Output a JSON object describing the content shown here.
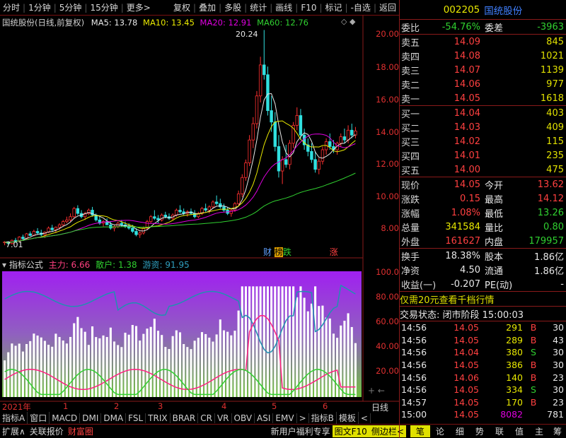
{
  "toolbar": {
    "items": [
      "分时",
      "1分钟",
      "5分钟",
      "15分钟",
      "更多>"
    ],
    "right": [
      "复权",
      "叠加",
      "多股",
      "统计",
      "画线",
      "F10",
      "标记",
      "-自选",
      "返回"
    ]
  },
  "chart": {
    "title": "国统股份(日线,前复权)",
    "ma5": "MA5: 13.78",
    "ma10": "MA10: 13.45",
    "ma20": "MA20: 12.91",
    "ma60": "MA60: 12.76",
    "high_label": "20.24",
    "low_label": "7.01",
    "yaxis": [
      "20.00",
      "18.00",
      "16.00",
      "14.00",
      "12.00",
      "10.00",
      "8.00"
    ],
    "events": [
      "财",
      "榜",
      "跌",
      "涨"
    ],
    "ohlc": [
      [
        7.2,
        7.3,
        7.05,
        7.25
      ],
      [
        7.25,
        7.3,
        7.1,
        7.15
      ],
      [
        7.15,
        7.4,
        7.1,
        7.35
      ],
      [
        7.35,
        7.5,
        7.2,
        7.3
      ],
      [
        7.3,
        7.6,
        7.25,
        7.55
      ],
      [
        7.55,
        7.7,
        7.4,
        7.45
      ],
      [
        7.45,
        7.8,
        7.4,
        7.75
      ],
      [
        7.75,
        7.9,
        7.6,
        7.65
      ],
      [
        7.65,
        8.0,
        7.6,
        7.9
      ],
      [
        7.9,
        8.1,
        7.7,
        7.8
      ],
      [
        7.8,
        8.0,
        7.6,
        7.7
      ],
      [
        7.7,
        7.9,
        7.5,
        7.85
      ],
      [
        7.85,
        8.2,
        7.8,
        8.1
      ],
      [
        8.1,
        8.3,
        7.9,
        8.0
      ],
      [
        8.0,
        8.2,
        7.8,
        8.15
      ],
      [
        8.15,
        8.4,
        8.0,
        8.3
      ],
      [
        8.3,
        8.6,
        8.2,
        8.5
      ],
      [
        8.5,
        8.8,
        8.4,
        8.6
      ],
      [
        8.6,
        9.0,
        8.5,
        8.8
      ],
      [
        8.8,
        9.4,
        8.7,
        9.3
      ],
      [
        9.3,
        9.5,
        8.9,
        9.0
      ],
      [
        9.0,
        9.2,
        8.7,
        8.8
      ],
      [
        8.8,
        9.1,
        8.6,
        9.0
      ],
      [
        9.0,
        9.3,
        8.9,
        9.2
      ],
      [
        9.2,
        9.4,
        8.8,
        8.9
      ],
      [
        8.9,
        9.0,
        8.5,
        8.6
      ],
      [
        8.6,
        8.8,
        8.3,
        8.4
      ],
      [
        8.4,
        8.6,
        8.2,
        8.5
      ],
      [
        8.5,
        8.7,
        8.3,
        8.3
      ],
      [
        8.3,
        8.5,
        8.0,
        8.1
      ],
      [
        8.1,
        8.3,
        7.9,
        8.2
      ],
      [
        8.2,
        8.5,
        8.1,
        8.4
      ],
      [
        8.4,
        8.6,
        8.2,
        8.3
      ],
      [
        8.3,
        8.5,
        8.1,
        8.2
      ],
      [
        8.2,
        8.4,
        8.0,
        8.1
      ],
      [
        8.1,
        8.3,
        7.8,
        7.9
      ],
      [
        7.9,
        8.1,
        7.6,
        7.7
      ],
      [
        7.7,
        7.9,
        7.5,
        7.8
      ],
      [
        7.8,
        8.2,
        7.7,
        8.1
      ],
      [
        8.1,
        8.6,
        8.0,
        8.5
      ],
      [
        8.5,
        8.9,
        8.4,
        8.8
      ],
      [
        8.8,
        9.2,
        8.6,
        8.7
      ],
      [
        8.7,
        8.9,
        8.4,
        8.6
      ],
      [
        8.6,
        9.0,
        8.5,
        8.9
      ],
      [
        8.9,
        9.1,
        8.7,
        8.8
      ],
      [
        8.8,
        9.0,
        8.6,
        8.7
      ],
      [
        8.7,
        9.0,
        8.6,
        8.9
      ],
      [
        8.9,
        9.3,
        8.8,
        9.2
      ],
      [
        9.2,
        9.5,
        9.0,
        9.1
      ],
      [
        9.1,
        9.3,
        8.9,
        9.0
      ],
      [
        9.0,
        9.2,
        8.8,
        9.1
      ],
      [
        9.1,
        9.3,
        8.9,
        9.0
      ],
      [
        9.0,
        9.2,
        8.7,
        8.8
      ],
      [
        8.8,
        9.1,
        8.7,
        9.0
      ],
      [
        9.0,
        9.4,
        8.9,
        9.3
      ],
      [
        9.3,
        9.6,
        9.1,
        9.2
      ],
      [
        9.2,
        9.5,
        9.0,
        9.4
      ],
      [
        9.4,
        9.8,
        9.3,
        9.7
      ],
      [
        9.7,
        10.1,
        9.5,
        9.6
      ],
      [
        9.6,
        9.9,
        9.3,
        9.4
      ],
      [
        9.4,
        9.6,
        9.1,
        9.2
      ],
      [
        9.2,
        9.4,
        8.9,
        9.0
      ],
      [
        9.0,
        9.3,
        8.8,
        9.2
      ],
      [
        9.2,
        9.7,
        9.1,
        9.6
      ],
      [
        9.6,
        10.4,
        9.5,
        10.2
      ],
      [
        10.2,
        11.4,
        10.0,
        11.2
      ],
      [
        11.2,
        12.3,
        11.0,
        12.1
      ],
      [
        12.1,
        13.8,
        11.9,
        13.5
      ],
      [
        13.5,
        14.9,
        13.0,
        14.5
      ],
      [
        14.5,
        16.5,
        14.2,
        16.2
      ],
      [
        16.2,
        18.6,
        15.8,
        18.1
      ],
      [
        18.1,
        20.24,
        17.2,
        17.5
      ],
      [
        17.5,
        18.0,
        15.0,
        15.3
      ],
      [
        15.3,
        16.2,
        14.0,
        14.6
      ],
      [
        14.6,
        15.2,
        12.8,
        13.1
      ],
      [
        13.1,
        13.8,
        11.2,
        11.6
      ],
      [
        11.6,
        12.5,
        10.8,
        12.3
      ],
      [
        12.3,
        13.2,
        11.8,
        12.0
      ],
      [
        12.0,
        13.5,
        11.7,
        13.3
      ],
      [
        13.3,
        14.6,
        13.0,
        14.4
      ],
      [
        14.4,
        15.5,
        14.1,
        15.0
      ],
      [
        15.0,
        15.4,
        13.5,
        13.8
      ],
      [
        13.8,
        14.2,
        12.9,
        13.2
      ],
      [
        13.2,
        13.6,
        12.5,
        12.8
      ],
      [
        12.8,
        13.3,
        12.1,
        12.3
      ],
      [
        12.3,
        12.8,
        11.5,
        11.7
      ],
      [
        11.7,
        12.4,
        11.4,
        12.2
      ],
      [
        12.2,
        13.1,
        12.0,
        12.9
      ],
      [
        12.9,
        13.6,
        12.6,
        13.4
      ],
      [
        13.4,
        13.9,
        12.9,
        13.1
      ],
      [
        13.1,
        13.5,
        12.7,
        12.9
      ],
      [
        12.9,
        13.4,
        12.6,
        13.3
      ],
      [
        13.3,
        13.9,
        13.1,
        13.7
      ],
      [
        13.7,
        14.2,
        13.3,
        13.5
      ],
      [
        13.5,
        14.4,
        13.3,
        14.1
      ],
      [
        14.1,
        14.5,
        13.6,
        13.8
      ],
      [
        13.8,
        14.3,
        13.6,
        14.05
      ]
    ]
  },
  "indicator": {
    "title": "指标公式",
    "zl": "主力: 6.66",
    "sh": "散户: 1.38",
    "yz": "游资: 91.95",
    "yaxis": [
      "100.0",
      "80.00",
      "60.00",
      "40.00",
      "20.00"
    ]
  },
  "xaxis": {
    "year": "2021年",
    "months": [
      "1",
      "2",
      "3",
      "4",
      "5",
      "6"
    ],
    "period": "日线"
  },
  "tabs": [
    "指标A",
    "窗口",
    "MACD",
    "DMI",
    "DMA",
    "FSL",
    "TRIX",
    "BRAR",
    "CR",
    "VR",
    "OBV",
    "ASI",
    "EMV",
    ">",
    "指标B",
    "模板",
    "<"
  ],
  "bottom": {
    "left": [
      "扩展∧",
      "关联报价",
      "财富圈"
    ],
    "promo": "新用户福利专享",
    "right": [
      "图文F10",
      "侧边栏<"
    ],
    "nav": [
      "笔",
      "论",
      "细",
      "势",
      "联",
      "值",
      "主",
      "筹"
    ]
  },
  "quote": {
    "code": "002205",
    "name": "国统股份",
    "wb_label": "委比",
    "wb": "-54.76%",
    "wc_label": "委差",
    "wc": "-3963",
    "sells": [
      {
        "l": "卖五",
        "p": "14.09",
        "q": "845"
      },
      {
        "l": "卖四",
        "p": "14.08",
        "q": "1021"
      },
      {
        "l": "卖三",
        "p": "14.07",
        "q": "1139"
      },
      {
        "l": "卖二",
        "p": "14.06",
        "q": "977"
      },
      {
        "l": "卖一",
        "p": "14.05",
        "q": "1618"
      }
    ],
    "buys": [
      {
        "l": "买一",
        "p": "14.04",
        "q": "403"
      },
      {
        "l": "买二",
        "p": "14.03",
        "q": "409"
      },
      {
        "l": "买三",
        "p": "14.02",
        "q": "115"
      },
      {
        "l": "买四",
        "p": "14.01",
        "q": "235"
      },
      {
        "l": "买五",
        "p": "14.00",
        "q": "475"
      }
    ],
    "stats": [
      {
        "l": "现价",
        "v": "14.05",
        "l2": "今开",
        "v2": "13.62"
      },
      {
        "l": "涨跌",
        "v": "0.15",
        "l2": "最高",
        "v2": "14.12"
      },
      {
        "l": "涨幅",
        "v": "1.08%",
        "l2": "最低",
        "v2": "13.26"
      },
      {
        "l": "总量",
        "v": "341584",
        "l2": "量比",
        "v2": "0.80"
      },
      {
        "l": "外盘",
        "v": "161627",
        "l2": "内盘",
        "v2": "179957"
      }
    ],
    "stats2": [
      {
        "l": "换手",
        "v": "18.38%",
        "l2": "股本",
        "v2": "1.86亿"
      },
      {
        "l": "净资",
        "v": "4.50",
        "l2": "流通",
        "v2": "1.86亿"
      },
      {
        "l": "收益(一)",
        "v": "-0.207",
        "l2": "PE(动)",
        "v2": "-"
      }
    ],
    "promo": "仅需20元查看千档行情",
    "status": "交易状态: 闭市阶段 15:00:03",
    "ticks": [
      {
        "t": "14:56",
        "p": "14.05",
        "q": "291",
        "s": "B",
        "n": "30"
      },
      {
        "t": "14:56",
        "p": "14.05",
        "q": "289",
        "s": "B",
        "n": "43"
      },
      {
        "t": "14:56",
        "p": "14.04",
        "q": "380",
        "s": "S",
        "n": "30"
      },
      {
        "t": "14:56",
        "p": "14.05",
        "q": "386",
        "s": "B",
        "n": "30"
      },
      {
        "t": "14:56",
        "p": "14.06",
        "q": "140",
        "s": "B",
        "n": "23"
      },
      {
        "t": "14:56",
        "p": "14.05",
        "q": "334",
        "s": "S",
        "n": "30"
      },
      {
        "t": "14:57",
        "p": "14.05",
        "q": "170",
        "s": "B",
        "n": "23"
      },
      {
        "t": "15:00",
        "p": "14.05",
        "q": "8082",
        "s": "",
        "n": "781"
      }
    ]
  }
}
